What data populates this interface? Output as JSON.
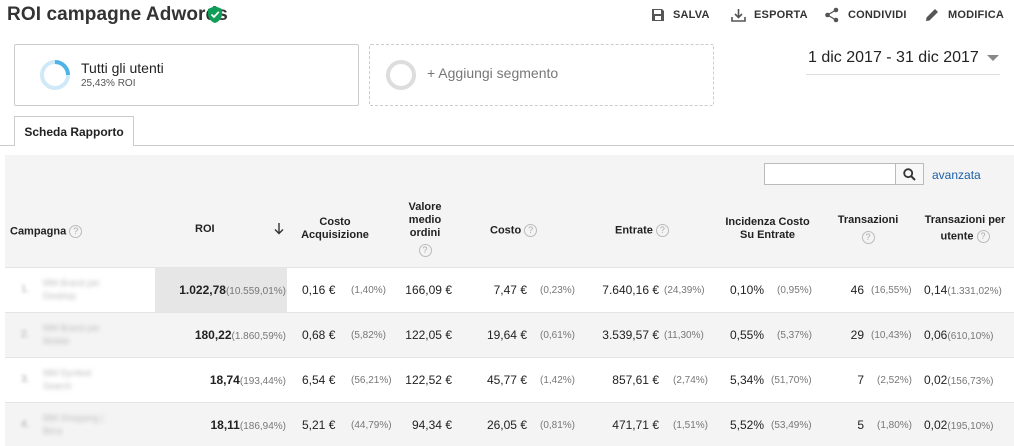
{
  "header": {
    "title": "ROI campagne Adwords",
    "actions": [
      {
        "label": "SALVA",
        "icon": "save-icon"
      },
      {
        "label": "ESPORTA",
        "icon": "export-icon"
      },
      {
        "label": "CONDIVIDI",
        "icon": "share-icon"
      },
      {
        "label": "MODIFICA",
        "icon": "edit-icon"
      }
    ]
  },
  "segments": {
    "active": {
      "name": "Tutti gli utenti",
      "sub": "25,43% ROI"
    },
    "add_label": "+ Aggiungi segmento"
  },
  "daterange": "1 dic 2017 - 31 dic 2017",
  "tab": "Scheda Rapporto",
  "search": {
    "placeholder": "",
    "advanced": "avanzata"
  },
  "table": {
    "columns": {
      "campaign": "Campagna",
      "roi": "ROI",
      "cost_acq_1": "Costo",
      "cost_acq_2": "Acquisizione",
      "avg_order_1": "Valore",
      "avg_order_2": "medio",
      "avg_order_3": "ordini",
      "cost": "Costo",
      "revenue": "Entrate",
      "incidence_1": "Incidenza Costo",
      "incidence_2": "Su Entrate",
      "transactions": "Transazioni",
      "tpu_1": "Transazioni per",
      "tpu_2": "utente"
    },
    "help_glyph": "?",
    "rows": [
      {
        "num": "1.",
        "campaign_1": "MM Brand per",
        "campaign_2": "Desktop",
        "roi": "1.022,78",
        "roi_pct": "(10.559,01%)",
        "cost_acq": "0,16 €",
        "cost_acq_pct": "(1,40%)",
        "avg_order": "166,09 €",
        "cost": "7,47 €",
        "cost_pct": "(0,23%)",
        "revenue": "7.640,16 €",
        "revenue_pct": "(24,39%)",
        "incidence": "0,10%",
        "incidence_pct": "(0,95%)",
        "transactions": "46",
        "transactions_pct": "(16,55%)",
        "tpu": "0,14",
        "tpu_pct": "(1.331,02%)"
      },
      {
        "num": "2.",
        "campaign_1": "MM Brand per",
        "campaign_2": "Mobile",
        "roi": "180,22",
        "roi_pct": "(1.860,59%)",
        "cost_acq": "0,68 €",
        "cost_acq_pct": "(5,82%)",
        "avg_order": "122,05 €",
        "cost": "19,64 €",
        "cost_pct": "(0,61%)",
        "revenue": "3.539,57 €",
        "revenue_pct": "(11,30%)",
        "incidence": "0,55%",
        "incidence_pct": "(5,37%)",
        "transactions": "29",
        "transactions_pct": "(10,43%)",
        "tpu": "0,06",
        "tpu_pct": "(610,10%)"
      },
      {
        "num": "3.",
        "campaign_1": "MM Dynfeet",
        "campaign_2": "Search",
        "roi": "18,74",
        "roi_pct": "(193,44%)",
        "cost_acq": "6,54 €",
        "cost_acq_pct": "(56,21%)",
        "avg_order": "122,52 €",
        "cost": "45,77 €",
        "cost_pct": "(1,42%)",
        "revenue": "857,61 €",
        "revenue_pct": "(2,74%)",
        "incidence": "5,34%",
        "incidence_pct": "(51,70%)",
        "transactions": "7",
        "transactions_pct": "(2,52%)",
        "tpu": "0,02",
        "tpu_pct": "(156,73%)"
      },
      {
        "num": "4.",
        "campaign_1": "MM Shopping |",
        "campaign_2": "Birra",
        "roi": "18,11",
        "roi_pct": "(186,94%)",
        "cost_acq": "5,21 €",
        "cost_acq_pct": "(44,79%)",
        "avg_order": "94,34 €",
        "cost": "26,05 €",
        "cost_pct": "(0,81%)",
        "revenue": "471,71 €",
        "revenue_pct": "(1,51%)",
        "incidence": "5,52%",
        "incidence_pct": "(53,49%)",
        "transactions": "5",
        "transactions_pct": "(1,80%)",
        "tpu": "0,02",
        "tpu_pct": "(195,10%)"
      }
    ]
  },
  "colors": {
    "accent": "#1a5fa8",
    "verified": "#0f9d58",
    "ring": "#4fb3e8"
  }
}
